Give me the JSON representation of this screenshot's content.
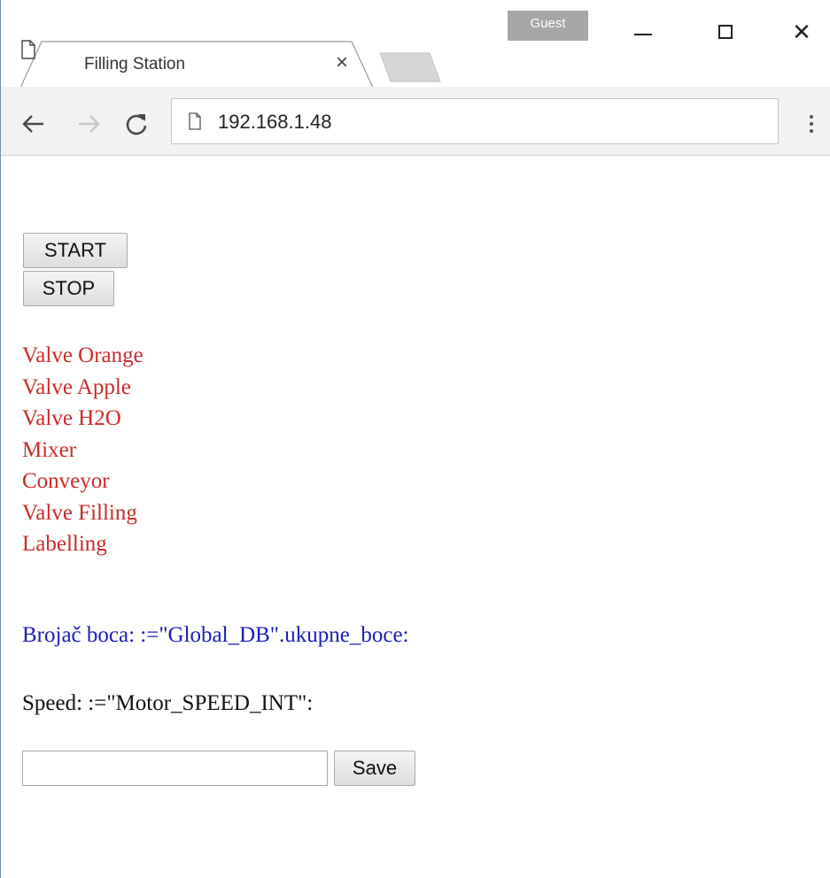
{
  "browser": {
    "profile_badge": "Guest",
    "tab": {
      "title": "Filling Station",
      "close_glyph": "×"
    },
    "window_controls": {
      "close_glyph": "✕"
    },
    "address_bar": {
      "url": "192.168.1.48"
    },
    "icons": [
      "page-icon",
      "back-arrow-icon",
      "forward-arrow-icon",
      "reload-icon",
      "menu-kebab-icon",
      "minimize-icon",
      "maximize-icon",
      "close-icon"
    ]
  },
  "page": {
    "buttons": {
      "start_label": "START",
      "stop_label": "STOP",
      "save_label": "Save"
    },
    "statuses": [
      "Valve Orange",
      "Valve Apple",
      "Valve H2O",
      "Mixer",
      "Conveyor",
      "Valve Filling",
      "Labelling"
    ],
    "counter_text": "Brojač boca: :=\"Global_DB\".ukupne_boce:",
    "speed_text": "Speed: :=\"Motor_SPEED_INT\":",
    "speed_input": {
      "value": "",
      "placeholder": ""
    }
  },
  "colors": {
    "status_text": "#cc2a2a",
    "counter_text": "#1c1cb8",
    "guest_badge": "#a7a7a7",
    "toolbar_bg": "#f2f2f2"
  }
}
